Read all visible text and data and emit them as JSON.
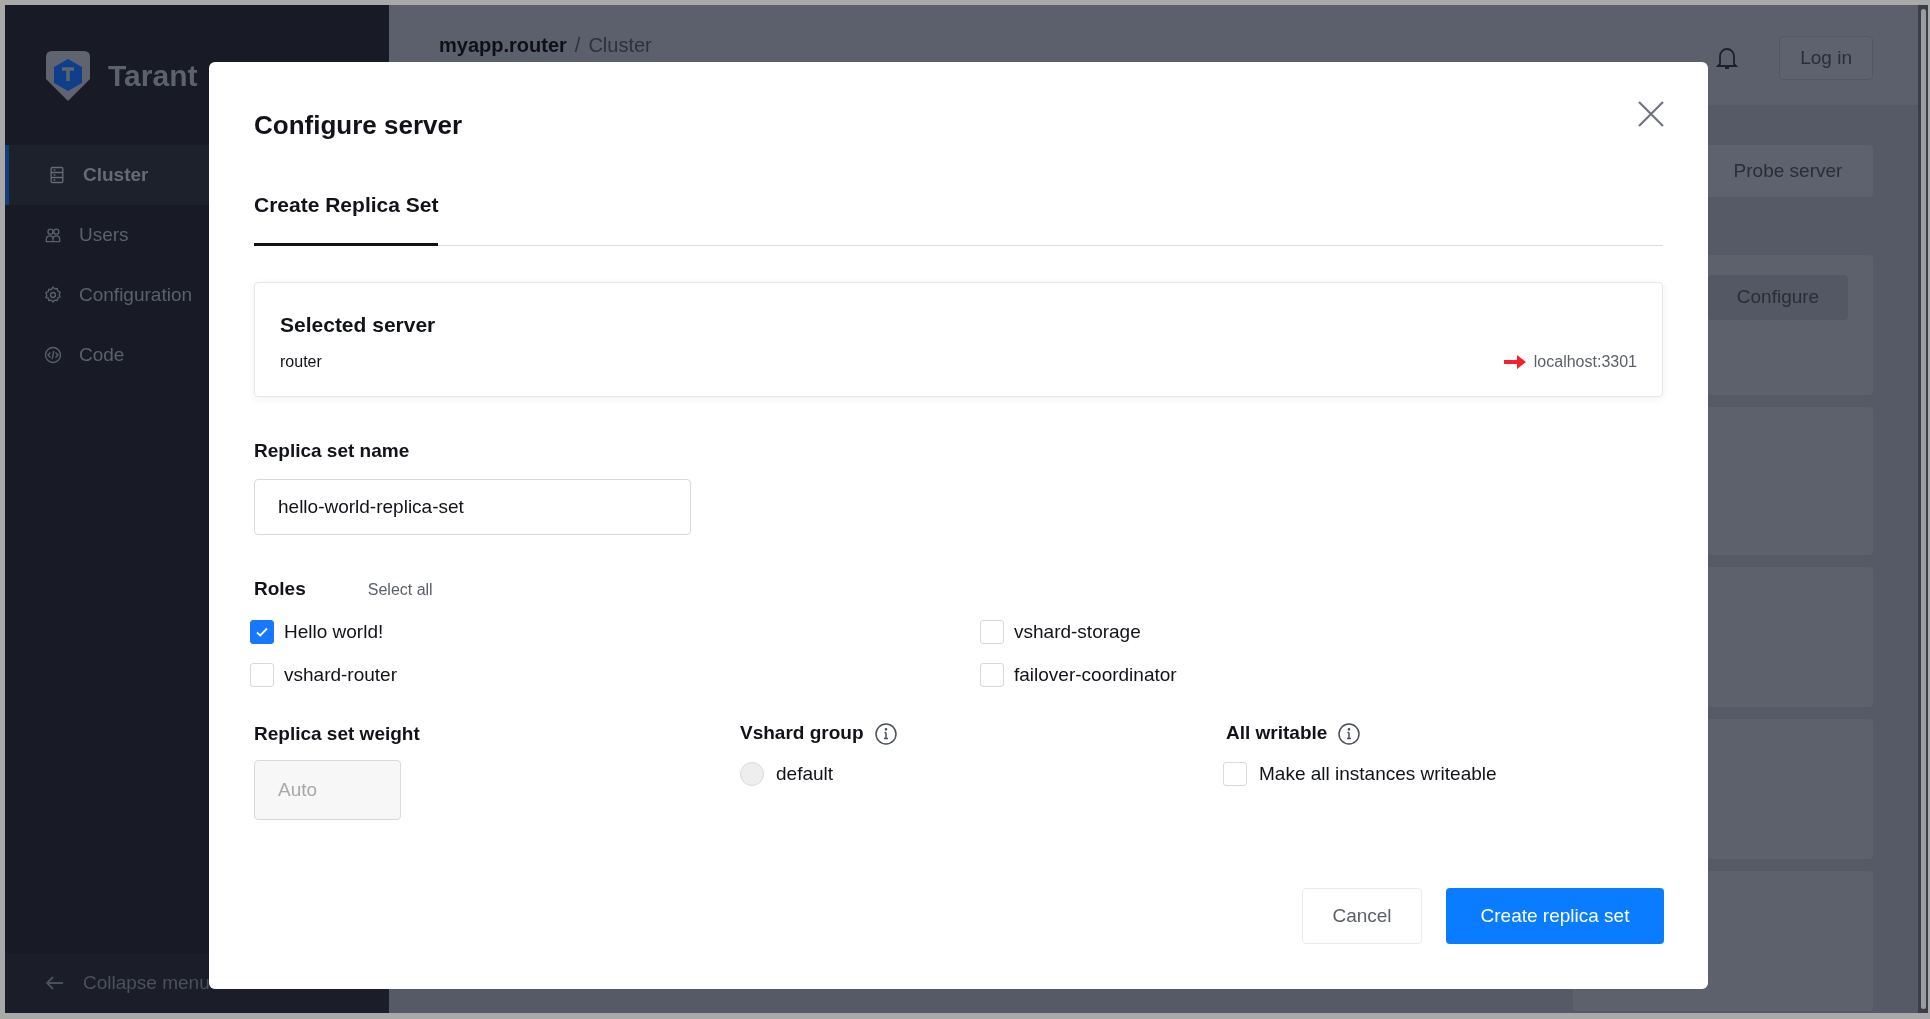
{
  "app": {
    "logo_text": "Tarant"
  },
  "sidebar": {
    "items": [
      {
        "label": "Cluster",
        "kind": "server",
        "selected": true
      },
      {
        "label": "Users",
        "kind": "users",
        "selected": false
      },
      {
        "label": "Configuration",
        "kind": "gear",
        "selected": false
      },
      {
        "label": "Code",
        "kind": "code",
        "selected": false
      }
    ],
    "collapse": "Collapse menu"
  },
  "header": {
    "breadcrumb": [
      "myapp.router",
      "Cluster"
    ],
    "separator": "/",
    "login": "Log in"
  },
  "background": {
    "probe": "Probe server",
    "configure": "Configure"
  },
  "dialog": {
    "title": "Configure server",
    "tabs": [
      {
        "label": "Create Replica Set",
        "selected": true
      }
    ],
    "selected_server": {
      "title": "Selected server",
      "alias": "router",
      "uri": "localhost:3301"
    },
    "replica_set_name": {
      "label": "Replica set name",
      "value": "hello-world-replica-set"
    },
    "roles": {
      "label": "Roles",
      "select_all": "Select all",
      "items": [
        {
          "label": "Hello world!",
          "checked": true
        },
        {
          "label": "vshard-storage",
          "checked": false
        },
        {
          "label": "vshard-router",
          "checked": false
        },
        {
          "label": "failover-coordinator",
          "checked": false
        }
      ]
    },
    "weight": {
      "label": "Replica set weight",
      "placeholder": "Auto",
      "disabled": true
    },
    "vshard_group": {
      "label": "Vshard group",
      "options": [
        {
          "label": "default",
          "selected": false,
          "disabled": true
        }
      ]
    },
    "all_writable": {
      "label": "All writable",
      "option": "Make all instances writeable",
      "checked": false
    },
    "buttons": {
      "cancel": "Cancel",
      "submit": "Create replica set"
    }
  }
}
